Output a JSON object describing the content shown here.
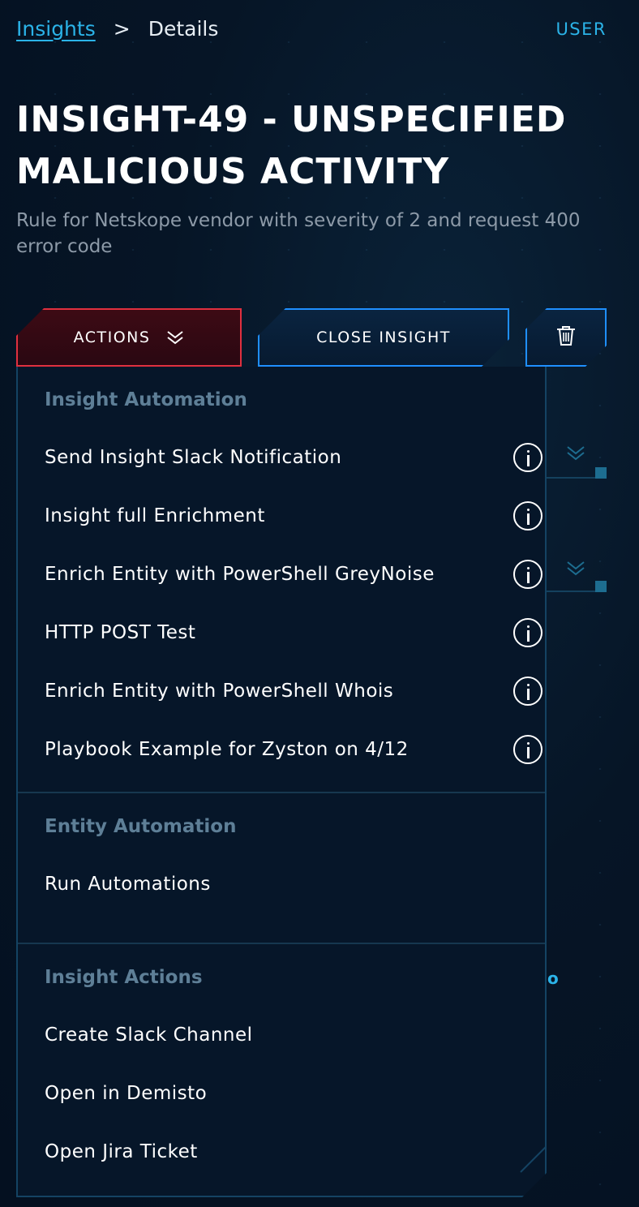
{
  "breadcrumb": {
    "parent": "Insights",
    "separator": ">",
    "current": "Details"
  },
  "header": {
    "user_label": "USER"
  },
  "insight": {
    "title": "INSIGHT-49 - UNSPECIFIED MALICIOUS ACTIVITY",
    "description": "Rule for Netskope vendor with severity of 2 and request 400 error code"
  },
  "toolbar": {
    "actions_label": "ACTIONS",
    "close_label": "CLOSE INSIGHT",
    "delete_icon": "trash-icon"
  },
  "background": {
    "partial_text": "o"
  },
  "menu": {
    "sections": [
      {
        "header": "Insight Automation",
        "items": [
          {
            "label": "Send Insight Slack Notification",
            "icon": "info-icon"
          },
          {
            "label": "Insight full Enrichment",
            "icon": "info-icon"
          },
          {
            "label": "Enrich Entity with PowerShell GreyNoise",
            "icon": "info-icon"
          },
          {
            "label": "HTTP POST Test",
            "icon": "info-icon"
          },
          {
            "label": "Enrich Entity with PowerShell Whois",
            "icon": "info-icon"
          },
          {
            "label": "Playbook Example for Zyston on 4/12",
            "icon": "info-icon"
          }
        ]
      },
      {
        "header": "Entity Automation",
        "items": [
          {
            "label": "Run Automations"
          }
        ]
      },
      {
        "header": "Insight Actions",
        "items": [
          {
            "label": "Create Slack Channel"
          },
          {
            "label": "Open in Demisto"
          },
          {
            "label": "Open Jira Ticket"
          }
        ]
      }
    ]
  },
  "colors": {
    "accent": "#2bb3e8",
    "danger": "#e0303f",
    "primary_border": "#1f8fff",
    "background": "#061526"
  }
}
